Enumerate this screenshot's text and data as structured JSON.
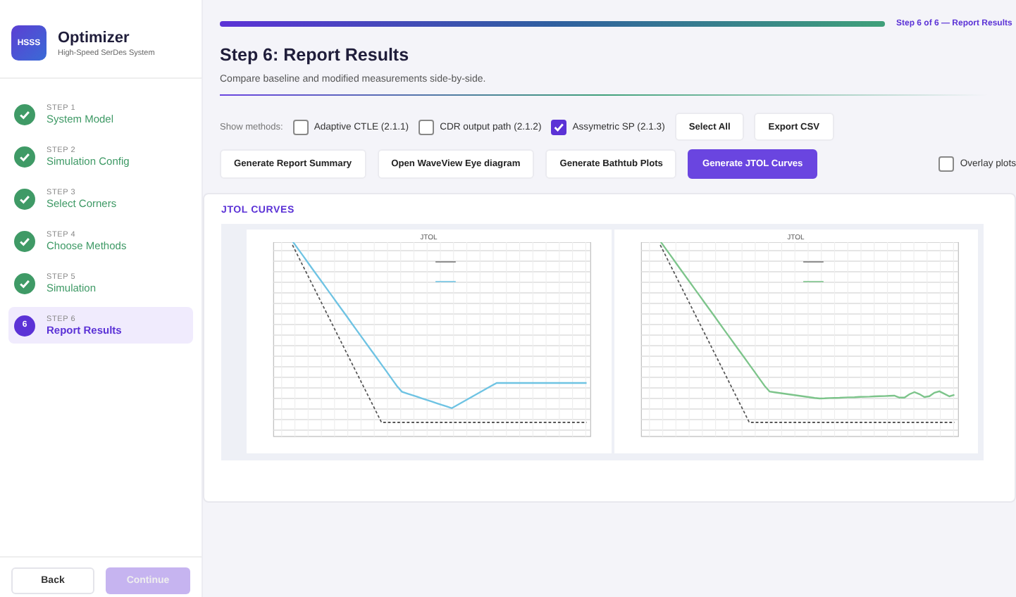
{
  "app": {
    "logo": "HSSS",
    "title": "Optimizer",
    "subtitle": "High-Speed SerDes System"
  },
  "steps": [
    {
      "step": "STEP 1",
      "label": "System Model",
      "kind": "done",
      "selected": false
    },
    {
      "step": "STEP 2",
      "label": "Simulation Config",
      "kind": "done",
      "selected": false
    },
    {
      "step": "STEP 3",
      "label": "Select Corners",
      "kind": "done",
      "selected": false
    },
    {
      "step": "STEP 4",
      "label": "Choose Methods",
      "kind": "done",
      "selected": false
    },
    {
      "step": "STEP 5",
      "label": "Simulation",
      "kind": "done",
      "selected": false
    },
    {
      "step": "STEP 6",
      "number": "6",
      "label": "Report Results",
      "kind": "current",
      "selected": true
    }
  ],
  "footer": {
    "back": "Back",
    "continue": "Continue",
    "continue_disabled": true
  },
  "progress": {
    "level": 1,
    "label": "Step 6 of 6 — Report Results"
  },
  "heading": "Step 6: Report Results",
  "description": "Compare baseline and modified measurements side-by-side.",
  "methods_label": "Show methods:",
  "methods": [
    {
      "label": "Adaptive CTLE (2.1.1)",
      "checked": false
    },
    {
      "label": "CDR output path (2.1.2)",
      "checked": false
    },
    {
      "label": "Assymetric SP (2.1.3)",
      "checked": true
    }
  ],
  "method_buttons": [
    "Select All",
    "Export CSV"
  ],
  "actions": [
    {
      "label": "Generate Report Summary",
      "selected": false
    },
    {
      "label": "Open WaveView Eye diagram",
      "selected": false
    },
    {
      "label": "Generate Bathtub Plots",
      "selected": false
    },
    {
      "label": "Generate JTOL Curves",
      "selected": true
    }
  ],
  "overlay": {
    "label": "Overlay plots",
    "checked": false
  },
  "section_title": "JTOL CURVES",
  "plots": [
    {
      "title": "JTOL",
      "color": "#6ec3e3"
    },
    {
      "title": "JTOL",
      "color": "#7cc48a"
    }
  ]
}
